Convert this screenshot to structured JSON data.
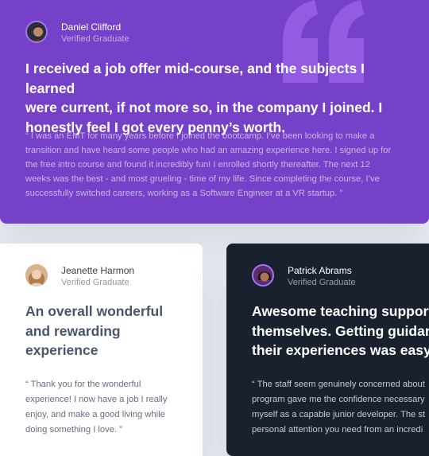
{
  "colors": {
    "purple": "#7541c8",
    "dark_blue": "#19212e",
    "white": "#ffffff",
    "grayish_blue": "#48556a",
    "light_gray": "#eef1f6",
    "accent_violet": "#a775f1"
  },
  "testimonials": [
    {
      "name": "Daniel Clifford",
      "role": "Verified Graduate",
      "headline": "I received a job offer mid-course, and the subjects I learned\nwere current, if not more so, in the company I joined. I\nhonestly feel I got every penny’s worth.",
      "body": "“ I was an EMT for many years before I joined the bootcamp. I’ve been looking to make a\ntransition and have heard some people who had an amazing experience here. I signed up for\nthe free intro course and found it incredibly fun! I enrolled shortly thereafter. The next 12\nweeks was the  best - and most grueling - time of my life. Since completing the course, I’ve\nsuccessfully switched careers, working as a Software Engineer at a VR startup. ”",
      "icon": "quotation-mark-icon"
    },
    {
      "name": "Jeanette Harmon",
      "role": "Verified Graduate",
      "headline": "An overall wonderful\nand rewarding\nexperience",
      "body": "“ Thank you for the wonderful\nexperience! I now have a job I really\nenjoy, and make a good living while\ndoing something I love. ”"
    },
    {
      "name": "Patrick Abrams",
      "role": "Verified Graduate",
      "headline": "Awesome teaching support f\nthemselves. Getting guidanc\ntheir experiences was easy.",
      "body": "“ The staff seem genuinely concerned about\nprogram gave me the confidence necessary\nmyself as a capable junior developer. The st\npersonal attention you need from an incredi"
    }
  ]
}
